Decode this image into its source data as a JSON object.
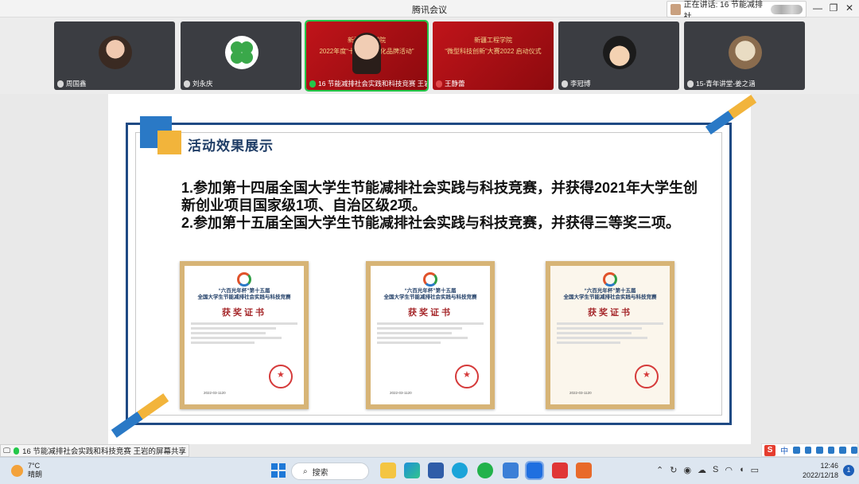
{
  "titlebar": {
    "title": "腾讯会议",
    "speaking": "正在讲话: 16 节能减排社...",
    "minimize": "—",
    "restore": "❐",
    "close": "✕"
  },
  "participants": [
    {
      "name": "周国鑫",
      "mic": "muted"
    },
    {
      "name": "刘永庆",
      "mic": "muted"
    },
    {
      "name": "16 节能减排社会实践和科技竞赛 王岩",
      "mic": "on",
      "tile_text_1": "新疆工程学院",
      "tile_text_2": "2022年度“十大校园文化品牌活动”"
    },
    {
      "name": "王静蕾",
      "mic": "off",
      "tile_text_1": "新疆工程学院",
      "tile_text_2": "“微型科技创新”大赛2022 启动仪式"
    },
    {
      "name": "李冠博",
      "mic": "muted"
    },
    {
      "name": "15-青年讲堂-姜之涵",
      "mic": "muted"
    }
  ],
  "slide": {
    "heading": "活动效果展示",
    "line1": "1.参加第十四届全国大学生节能减排社会实践与科技竞赛，并获得2021年大学生创新创业项目国家级1项、自治区级2项。",
    "line2": "2.参加第十五届全国大学生节能减排社会实践与科技竞赛，并获得三等奖三项。",
    "certificates": [
      {
        "header1": "“六百光年杯”第十五届",
        "header2": "全国大学生节能减排社会实践与科技竞赛",
        "title": "获奖证书",
        "date": "2022-03-1120"
      },
      {
        "header1": "“六百光年杯”第十五届",
        "header2": "全国大学生节能减排社会实践与科技竞赛",
        "title": "获奖证书",
        "date": "2022-03-1120"
      },
      {
        "header1": "“六百光年杯”第十五届",
        "header2": "全国大学生节能减排社会实践与科技竞赛",
        "title": "获奖证书",
        "date": "2022-03-1120"
      }
    ]
  },
  "sharebar": {
    "text": "16 节能减排社会实践和科技竞赛 王岩的屏幕共享"
  },
  "ime": {
    "label": "S",
    "mode": "中"
  },
  "taskbar": {
    "temp": "7°C",
    "weather": "晴朗",
    "search": "搜索",
    "time": "12:46",
    "date": "2022/12/18",
    "notifications": "1"
  },
  "colors": {
    "accent_blue": "#2a79c6",
    "accent_gold": "#f2b43b",
    "frame_navy": "#1f4a84",
    "speaking_green": "#23c74a"
  }
}
